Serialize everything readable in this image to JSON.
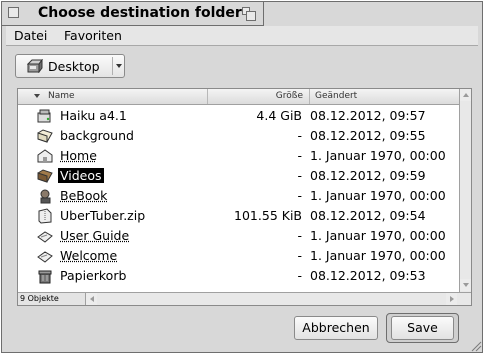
{
  "window": {
    "title": "Choose destination folder"
  },
  "menubar": {
    "items": [
      "Datei",
      "Favoriten"
    ]
  },
  "location": {
    "label": "Desktop",
    "icon": "desktop-icon"
  },
  "columns": {
    "name": "Name",
    "size": "Größe",
    "modified": "Geändert"
  },
  "rows": [
    {
      "name": "Haiku a4.1",
      "size": "4.4 GiB",
      "modified": "08.12.2012, 09:57",
      "icon": "drive-icon",
      "link": false,
      "selected": false
    },
    {
      "name": "background",
      "size": "-",
      "modified": "08.12.2012, 09:55",
      "icon": "folder-icon",
      "link": false,
      "selected": false
    },
    {
      "name": "Home",
      "size": "-",
      "modified": "1. Januar 1970, 00:00",
      "icon": "home-folder-icon",
      "link": true,
      "selected": false
    },
    {
      "name": "Videos",
      "size": "-",
      "modified": "08.12.2012, 09:59",
      "icon": "folder-icon",
      "link": false,
      "selected": true
    },
    {
      "name": "BeBook",
      "size": "-",
      "modified": "1. Januar 1970, 00:00",
      "icon": "bebook-icon",
      "link": true,
      "selected": false
    },
    {
      "name": "UberTuber.zip",
      "size": "101.55 KiB",
      "modified": "08.12.2012, 09:54",
      "icon": "zip-archive-icon",
      "link": false,
      "selected": false
    },
    {
      "name": "User Guide",
      "size": "-",
      "modified": "1. Januar 1970, 00:00",
      "icon": "document-link-icon",
      "link": true,
      "selected": false
    },
    {
      "name": "Welcome",
      "size": "-",
      "modified": "1. Januar 1970, 00:00",
      "icon": "document-link-icon",
      "link": true,
      "selected": false
    },
    {
      "name": "Papierkorb",
      "size": "-",
      "modified": "08.12.2012, 09:53",
      "icon": "trash-icon",
      "link": false,
      "selected": false
    }
  ],
  "status": {
    "count": "9 Objekte"
  },
  "buttons": {
    "cancel": "Abbrechen",
    "save": "Save"
  }
}
